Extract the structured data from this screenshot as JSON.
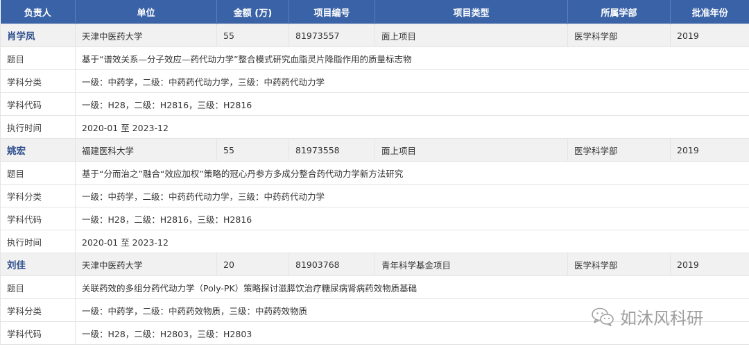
{
  "columns": [
    "负责人",
    "单位",
    "金额 (万)",
    "项目编号",
    "项目类型",
    "所属学部",
    "批准年份"
  ],
  "field_labels": {
    "title": "题目",
    "category": "学科分类",
    "code": "学科代码",
    "period": "执行时间"
  },
  "projects": [
    {
      "name": "肖学凤",
      "unit": "天津中医药大学",
      "amount": "55",
      "number": "81973557",
      "type": "面上项目",
      "department": "医学科学部",
      "year": "2019",
      "title": "基于“谱效关系—分子效应—药代动力学”整合模式研究血脂灵片降脂作用的质量标志物",
      "category": "一级：中药学，二级：中药药代动力学，三级：中药药代动力学",
      "code": "一级：H28，二级：H2816，三级：H2816",
      "period": "2020-01 至 2023-12"
    },
    {
      "name": "姚宏",
      "unit": "福建医科大学",
      "amount": "55",
      "number": "81973558",
      "type": "面上项目",
      "department": "医学科学部",
      "year": "2019",
      "title": "基于“分而治之”融合“效应加权”策略的冠心丹参方多成分整合药代动力学新方法研究",
      "category": "一级：中药学，二级：中药药代动力学，三级：中药药代动力学",
      "code": "一级：H28，二级：H2816，三级：H2816",
      "period": "2020-01 至 2023-12"
    },
    {
      "name": "刘佳",
      "unit": "天津中医药大学",
      "amount": "20",
      "number": "81903768",
      "type": "青年科学基金项目",
      "department": "医学科学部",
      "year": "2019",
      "title": "关联药效的多组分药代动力学（Poly-PK）策略探讨滋膵饮治疗糖尿病肾病药效物质基础",
      "category": "一级：中药学，二级：中药药效物质，三级：中药药效物质",
      "code": "一级：H28，二级：H2803，三级：H2803"
    }
  ],
  "watermark": {
    "text": "如沐风科研",
    "icon": "wechat-icon"
  }
}
